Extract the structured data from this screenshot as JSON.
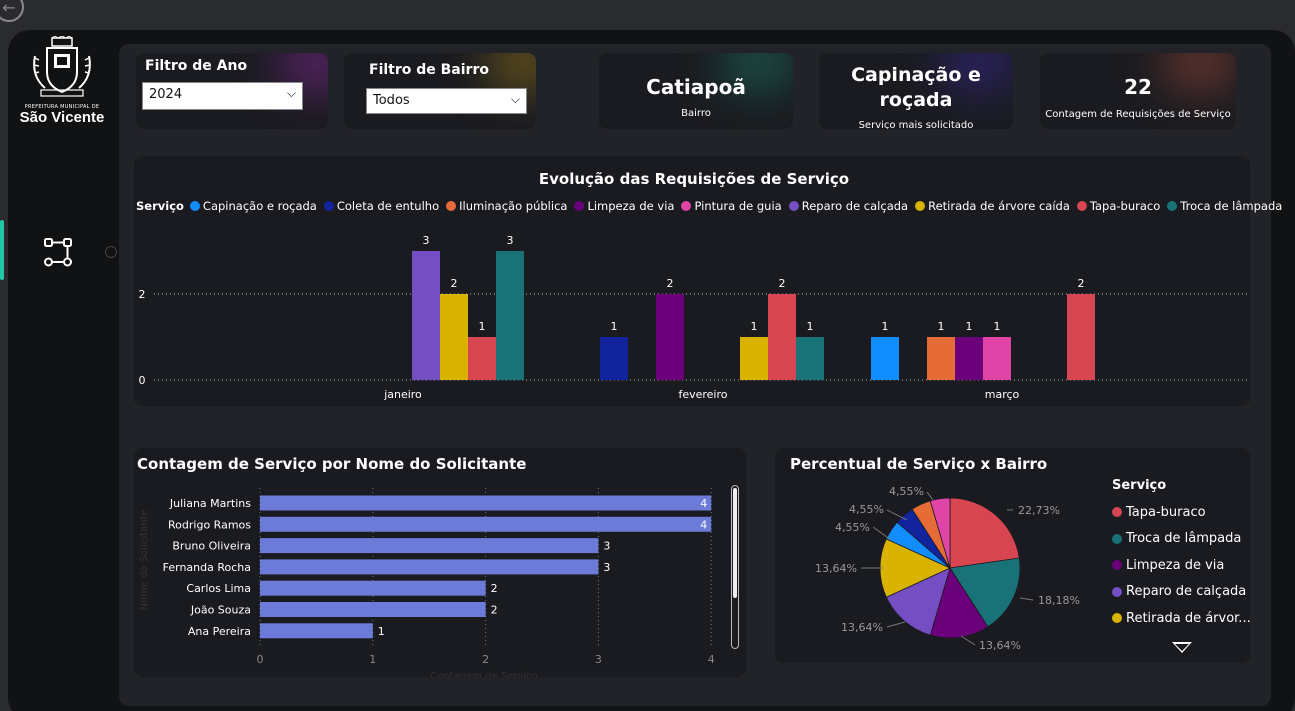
{
  "sidebar": {
    "logo_small": "PREFEITURA MUNICIPAL DE",
    "logo_big": "São Vicente",
    "nav_icon": "flow-diagram-icon"
  },
  "filters": {
    "year": {
      "title": "Filtro de Ano",
      "value": "2024"
    },
    "neighborhood": {
      "title": "Filtro de Bairro",
      "value": "Todos"
    }
  },
  "kpis": {
    "bairro": {
      "value": "Catiapoã",
      "label": "Bairro"
    },
    "servico": {
      "value": "Capinação e roçada",
      "label": "Serviço mais solicitado"
    },
    "contagem": {
      "value": "22",
      "label": "Contagem de Requisições de Serviço"
    }
  },
  "colors": {
    "capinacao": "#118dff",
    "coleta": "#12239e",
    "iluminacao": "#e66c37",
    "limpeza": "#6b007b",
    "pintura": "#e044a7",
    "reparo": "#744ec2",
    "retirada": "#d9b300",
    "tapa": "#d64550",
    "troca": "#197278",
    "bar_hbar": "#6c7ad8"
  },
  "chart_data": [
    {
      "type": "bar",
      "title": "Evolução das Requisições de Serviço",
      "legend_title": "Serviço",
      "legend": [
        "Capinação e roçada",
        "Coleta de entulho",
        "Iluminação pública",
        "Limpeza de via",
        "Pintura de guia",
        "Reparo de calçada",
        "Retirada de árvore caída",
        "Tapa-buraco",
        "Troca de lâmpada"
      ],
      "categories": [
        "janeiro",
        "fevereiro",
        "março"
      ],
      "y_ticks": [
        "0",
        "2"
      ],
      "ylim": [
        0,
        3
      ],
      "grid": true,
      "series": [
        {
          "name": "Capinação e roçada",
          "values": [
            null,
            null,
            1
          ]
        },
        {
          "name": "Coleta de entulho",
          "values": [
            null,
            1,
            null
          ]
        },
        {
          "name": "Iluminação pública",
          "values": [
            null,
            null,
            1
          ]
        },
        {
          "name": "Limpeza de via",
          "values": [
            null,
            2,
            1
          ]
        },
        {
          "name": "Pintura de guia",
          "values": [
            null,
            null,
            1
          ]
        },
        {
          "name": "Reparo de calçada",
          "values": [
            3,
            null,
            null
          ]
        },
        {
          "name": "Retirada de árvore caída",
          "values": [
            2,
            1,
            null
          ]
        },
        {
          "name": "Tapa-buraco",
          "values": [
            1,
            2,
            2
          ]
        },
        {
          "name": "Troca de lâmpada",
          "values": [
            3,
            1,
            null
          ]
        }
      ]
    },
    {
      "type": "bar",
      "orientation": "horizontal",
      "title": "Contagem de Serviço por Nome do Solicitante",
      "ylabel": "Nome do Solicitante",
      "xlabel": "Contagem de Serviço",
      "categories": [
        "Juliana Martins",
        "Rodrigo Ramos",
        "Bruno Oliveira",
        "Fernanda Rocha",
        "Carlos Lima",
        "João Souza",
        "Ana Pereira"
      ],
      "values": [
        4,
        4,
        3,
        3,
        2,
        2,
        1
      ],
      "x_ticks": [
        "0",
        "1",
        "2",
        "3",
        "4"
      ],
      "xlim": [
        0,
        4
      ],
      "grid": true
    },
    {
      "type": "pie",
      "title": "Percentual de Serviço x Bairro",
      "legend_title": "Serviço",
      "legend": [
        "Tapa-buraco",
        "Troca de lâmpada",
        "Limpeza de via",
        "Reparo de calçada",
        "Retirada de árvor..."
      ],
      "slices": [
        {
          "name": "Tapa-buraco",
          "value": 22.73,
          "label": "22,73%"
        },
        {
          "name": "Troca de lâmpada",
          "value": 18.18,
          "label": "18,18%"
        },
        {
          "name": "Limpeza de via",
          "value": 13.64,
          "label": "13,64%"
        },
        {
          "name": "Reparo de calçada",
          "value": 13.64,
          "label": "13,64%"
        },
        {
          "name": "Retirada de árvore caída",
          "value": 13.64,
          "label": "13,64%"
        },
        {
          "name": "Capinação e roçada",
          "value": 4.55,
          "label": "4,55%"
        },
        {
          "name": "Coleta de entulho",
          "value": 4.55,
          "label": "4,55%"
        },
        {
          "name": "Iluminação pública",
          "value": 4.55,
          "label": "4,55%"
        },
        {
          "name": "Pintura de guia",
          "value": 4.55,
          "label": "4,55%"
        }
      ]
    }
  ]
}
